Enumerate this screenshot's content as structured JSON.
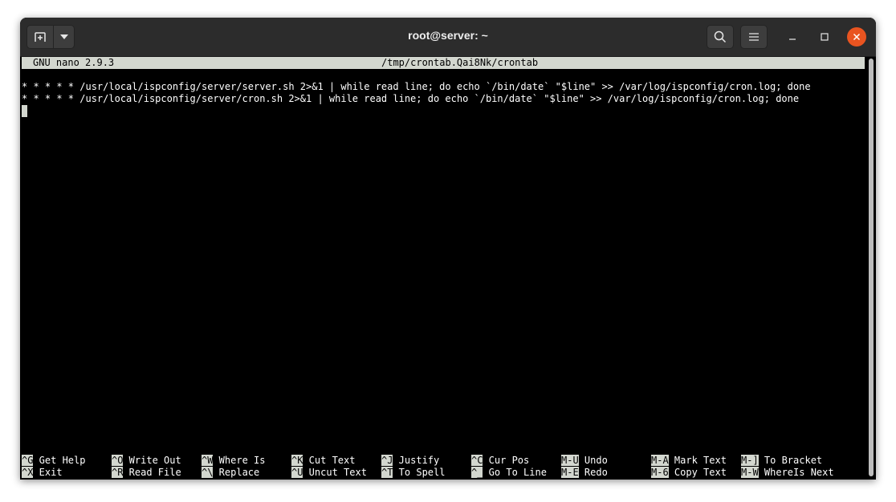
{
  "window": {
    "title": "root@server: ~"
  },
  "titlebar": {
    "new_tab_icon": "new-tab-icon",
    "dropdown_icon": "chevron-down-icon",
    "search_icon": "search-icon",
    "menu_icon": "hamburger-menu-icon",
    "minimize_icon": "minimize-icon",
    "maximize_icon": "maximize-icon",
    "close_icon": "close-icon",
    "close_color": "#e95420"
  },
  "nano": {
    "version": "GNU nano 2.9.3",
    "filename": "/tmp/crontab.Qai8Nk/crontab",
    "lines": [
      "* * * * * /usr/local/ispconfig/server/server.sh 2>&1 | while read line; do echo `/bin/date` \"$line\" >> /var/log/ispconfig/cron.log; done",
      "* * * * * /usr/local/ispconfig/server/cron.sh 2>&1 | while read line; do echo `/bin/date` \"$line\" >> /var/log/ispconfig/cron.log; done"
    ],
    "shortcuts_row1": [
      {
        "key": "^G",
        "label": " Get Help"
      },
      {
        "key": "^O",
        "label": " Write Out"
      },
      {
        "key": "^W",
        "label": " Where Is"
      },
      {
        "key": "^K",
        "label": " Cut Text"
      },
      {
        "key": "^J",
        "label": " Justify"
      },
      {
        "key": "^C",
        "label": " Cur Pos"
      },
      {
        "key": "M-U",
        "label": " Undo"
      },
      {
        "key": "M-A",
        "label": " Mark Text"
      },
      {
        "key": "M-]",
        "label": " To Bracket"
      }
    ],
    "shortcuts_row2": [
      {
        "key": "^X",
        "label": " Exit"
      },
      {
        "key": "^R",
        "label": " Read File"
      },
      {
        "key": "^\\",
        "label": " Replace"
      },
      {
        "key": "^U",
        "label": " Uncut Text"
      },
      {
        "key": "^T",
        "label": " To Spell"
      },
      {
        "key": "^_",
        "label": " Go To Line"
      },
      {
        "key": "M-E",
        "label": " Redo"
      },
      {
        "key": "M-6",
        "label": " Copy Text"
      },
      {
        "key": "M-W",
        "label": " WhereIs Next"
      }
    ],
    "header_bg": "#d3d7cf",
    "text_color": "#ffffff",
    "background": "#000000"
  }
}
